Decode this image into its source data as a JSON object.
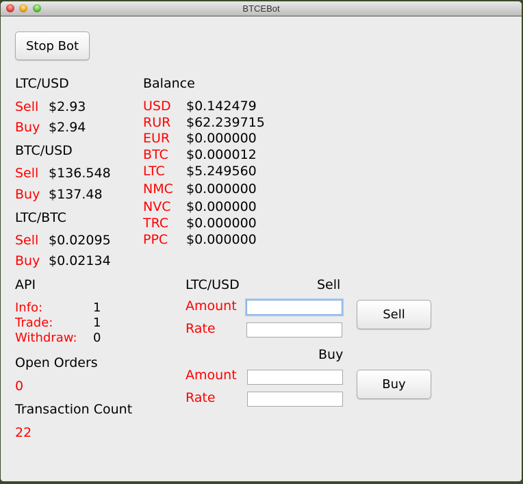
{
  "window": {
    "title": "BTCEBot"
  },
  "toolbar": {
    "stop_bot_label": "Stop Bot"
  },
  "tickers": [
    {
      "pair": "LTC/USD",
      "sell_label": "Sell",
      "sell": "$2.93",
      "buy_label": "Buy",
      "buy": "$2.94"
    },
    {
      "pair": "BTC/USD",
      "sell_label": "Sell",
      "sell": "$136.548",
      "buy_label": "Buy",
      "buy": "$137.48"
    },
    {
      "pair": "LTC/BTC",
      "sell_label": "Sell",
      "sell": "$0.02095",
      "buy_label": "Buy",
      "buy": "$0.02134"
    }
  ],
  "balance": {
    "title": "Balance",
    "items": [
      {
        "currency": "USD",
        "value": "$0.142479"
      },
      {
        "currency": "RUR",
        "value": "$62.239715"
      },
      {
        "currency": "EUR",
        "value": "$0.000000"
      },
      {
        "currency": "BTC",
        "value": "$0.000012"
      },
      {
        "currency": "LTC",
        "value": "$5.249560"
      },
      {
        "currency": "NMC",
        "value": "$0.000000"
      },
      {
        "currency": "NVC",
        "value": "$0.000000"
      },
      {
        "currency": "TRC",
        "value": "$0.000000"
      },
      {
        "currency": "PPC",
        "value": "$0.000000"
      }
    ]
  },
  "api": {
    "title": "API",
    "items": [
      {
        "label": "Info:",
        "value": "1"
      },
      {
        "label": "Trade:",
        "value": "1"
      },
      {
        "label": "Withdraw:",
        "value": "0"
      }
    ]
  },
  "open_orders": {
    "title": "Open Orders",
    "value": "0"
  },
  "transaction_count": {
    "title": "Transaction Count",
    "value": "22"
  },
  "trade": {
    "pair": "LTC/USD",
    "sell": {
      "title": "Sell",
      "amount_label": "Amount",
      "amount_value": "",
      "rate_label": "Rate",
      "rate_value": "",
      "button_label": "Sell"
    },
    "buy": {
      "title": "Buy",
      "amount_label": "Amount",
      "amount_value": "",
      "rate_label": "Rate",
      "rate_value": "",
      "button_label": "Buy"
    }
  },
  "colors": {
    "accent_label": "#ff0000",
    "focus_ring": "#7aa7de"
  }
}
